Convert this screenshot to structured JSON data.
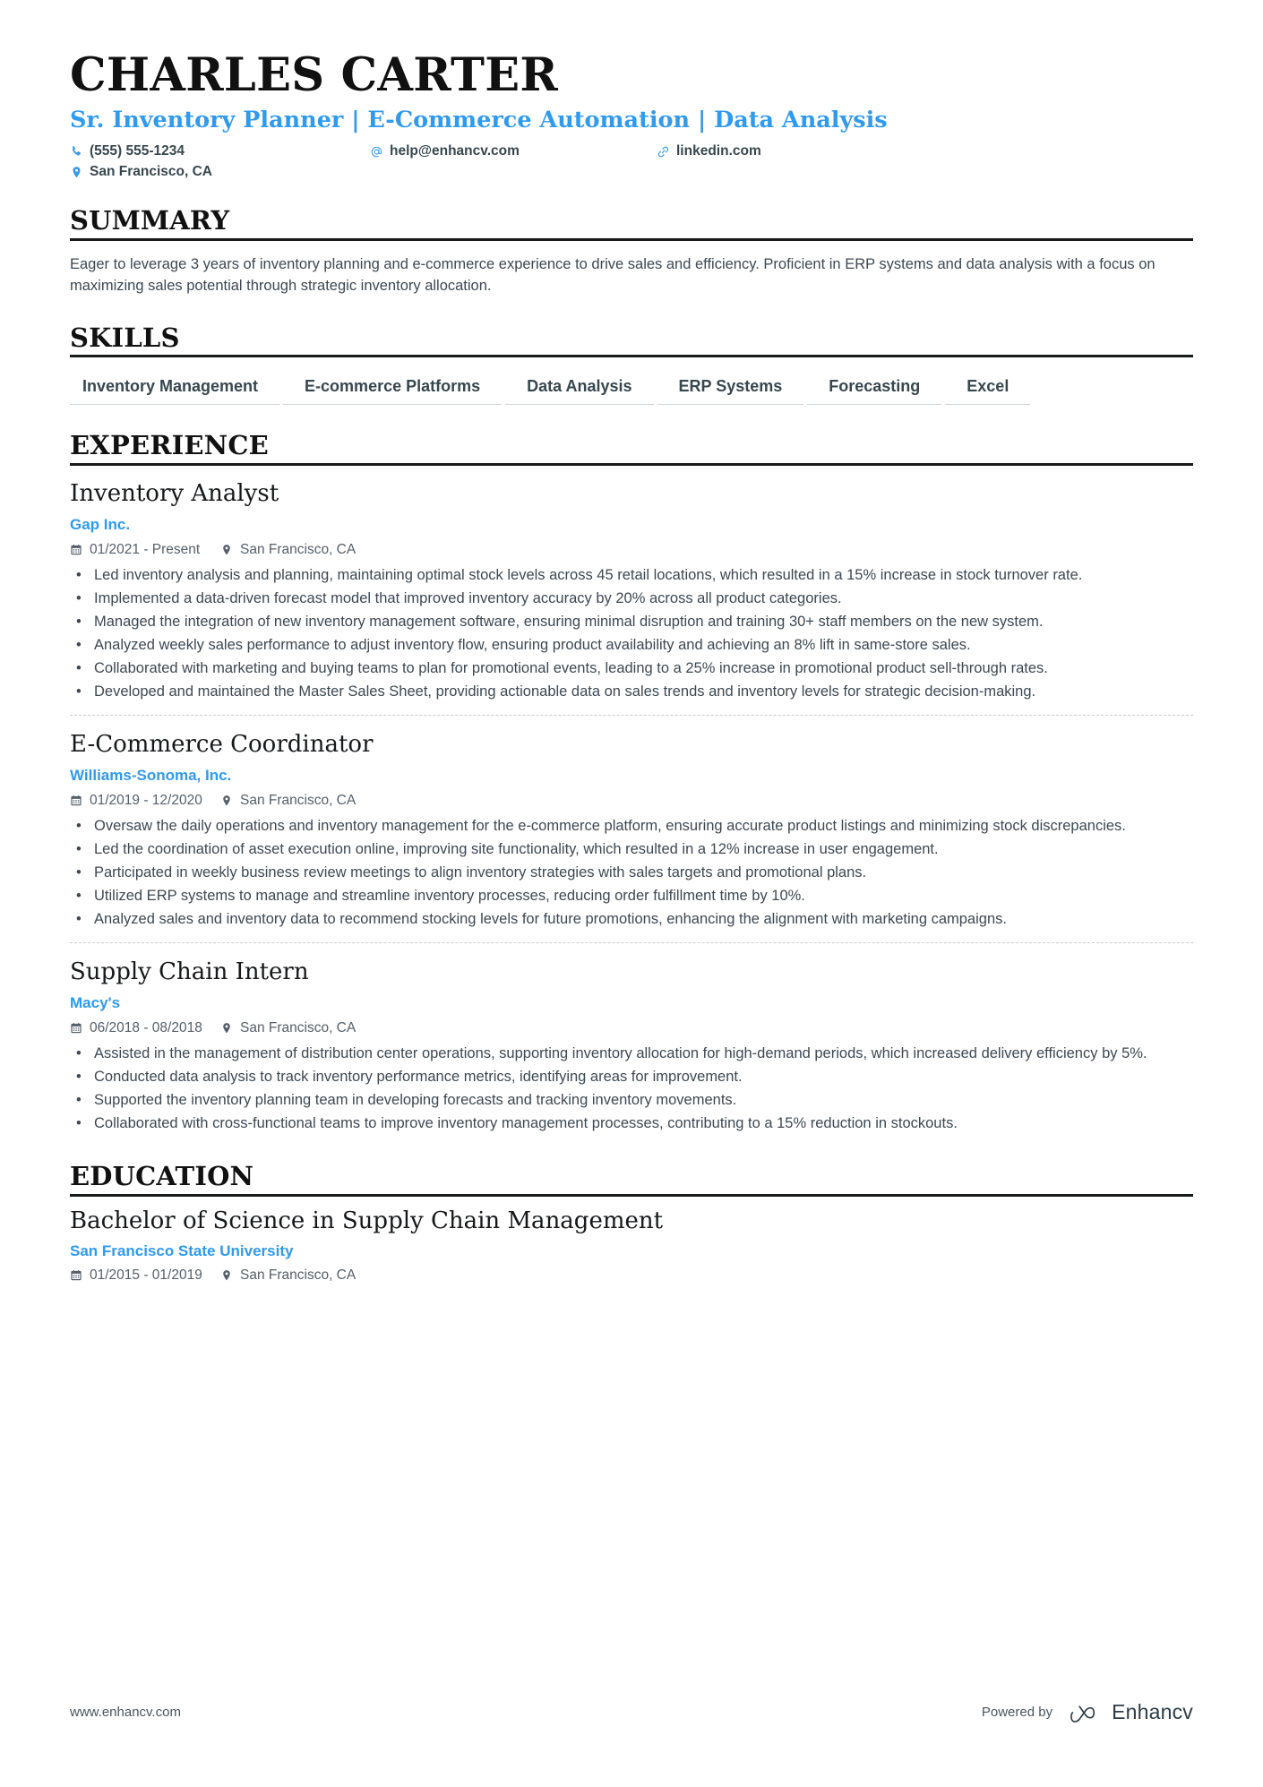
{
  "header": {
    "name": "CHARLES CARTER",
    "headline": "Sr. Inventory Planner | E-Commerce Automation | Data Analysis",
    "phone": "(555) 555-1234",
    "email": "help@enhancv.com",
    "website": "linkedin.com",
    "location": "San Francisco, CA",
    "accent_color": "#2f9aee",
    "text_color": "#37474f"
  },
  "summary": {
    "title": "SUMMARY",
    "text": "Eager to leverage 3 years of inventory planning and e-commerce experience to drive sales and efficiency. Proficient in ERP systems and data analysis with a focus on maximizing sales potential through strategic inventory allocation."
  },
  "skills": {
    "title": "SKILLS",
    "items": [
      "Inventory Management",
      "E-commerce Platforms",
      "Data Analysis",
      "ERP Systems",
      "Forecasting",
      "Excel"
    ]
  },
  "experience": {
    "title": "EXPERIENCE",
    "items": [
      {
        "job_title": "Inventory Analyst",
        "company": "Gap Inc.",
        "dates": "01/2021 - Present",
        "location": "San Francisco, CA",
        "bullets": [
          "Led inventory analysis and planning, maintaining optimal stock levels across 45 retail locations, which resulted in a 15% increase in stock turnover rate.",
          "Implemented a data-driven forecast model that improved inventory accuracy by 20% across all product categories.",
          "Managed the integration of new inventory management software, ensuring minimal disruption and training 30+ staff members on the new system.",
          "Analyzed weekly sales performance to adjust inventory flow, ensuring product availability and achieving an 8% lift in same-store sales.",
          "Collaborated with marketing and buying teams to plan for promotional events, leading to a 25% increase in promotional product sell-through rates.",
          "Developed and maintained the Master Sales Sheet, providing actionable data on sales trends and inventory levels for strategic decision-making."
        ]
      },
      {
        "job_title": "E-Commerce Coordinator",
        "company": "Williams-Sonoma, Inc.",
        "dates": "01/2019 - 12/2020",
        "location": "San Francisco, CA",
        "bullets": [
          "Oversaw the daily operations and inventory management for the e-commerce platform, ensuring accurate product listings and minimizing stock discrepancies.",
          "Led the coordination of asset execution online, improving site functionality, which resulted in a 12% increase in user engagement.",
          "Participated in weekly business review meetings to align inventory strategies with sales targets and promotional plans.",
          "Utilized ERP systems to manage and streamline inventory processes, reducing order fulfillment time by 10%.",
          "Analyzed sales and inventory data to recommend stocking levels for future promotions, enhancing the alignment with marketing campaigns."
        ]
      },
      {
        "job_title": "Supply Chain Intern",
        "company": "Macy's",
        "dates": "06/2018 - 08/2018",
        "location": "San Francisco, CA",
        "bullets": [
          "Assisted in the management of distribution center operations, supporting inventory allocation for high-demand periods, which increased delivery efficiency by 5%.",
          "Conducted data analysis to track inventory performance metrics, identifying areas for improvement.",
          "Supported the inventory planning team in developing forecasts and tracking inventory movements.",
          "Collaborated with cross-functional teams to improve inventory management processes, contributing to a 15% reduction in stockouts."
        ]
      }
    ]
  },
  "education": {
    "title": "EDUCATION",
    "items": [
      {
        "degree": "Bachelor of Science in Supply Chain Management",
        "school": "San Francisco State University",
        "dates": "01/2015 - 01/2019",
        "location": "San Francisco, CA"
      }
    ]
  },
  "footer": {
    "url": "www.enhancv.com",
    "powered_by": "Powered by",
    "brand": "Enhancv"
  },
  "icons": {
    "phone": "phone-icon",
    "email": "at-sign-icon",
    "link": "link-icon",
    "location": "map-pin-icon",
    "date": "calendar-icon"
  }
}
